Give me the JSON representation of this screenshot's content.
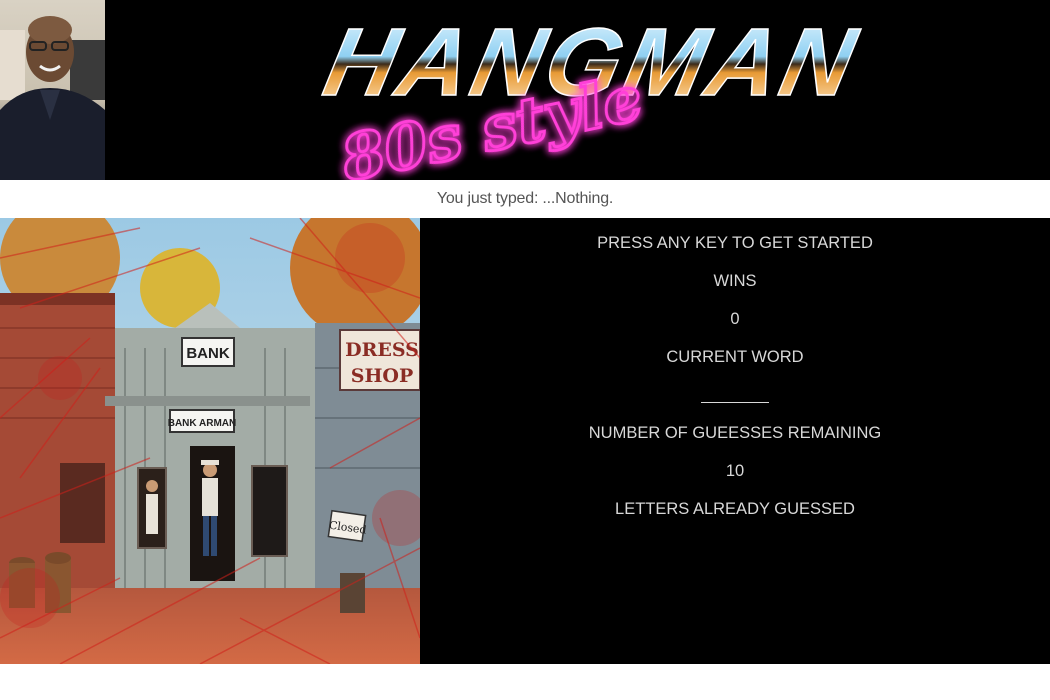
{
  "header": {
    "logo_title": "HANGMAN",
    "logo_subtitle": "80s style"
  },
  "typed_bar": {
    "text": "You just typed: ...Nothing."
  },
  "scene": {
    "sign_bank": "BANK",
    "sign_bank_arman": "BANK ARMAN",
    "sign_dress_shop_line1": "DRESS",
    "sign_dress_shop_line2": "SHOP",
    "sign_closed": "Closed"
  },
  "info": {
    "prompt": "PRESS ANY KEY TO GET STARTED",
    "wins_label": "WINS",
    "wins_value": "0",
    "current_word_label": "CURRENT WORD",
    "guesses_label": "NUMBER OF GUEESSES REMAINING",
    "guesses_value": "10",
    "letters_label": "LETTERS ALREADY GUESSED",
    "letters_value": ""
  },
  "colors": {
    "neon_pink": "#ff3fd8",
    "chrome_top": "#bfe9ff",
    "chrome_mid": "#e89a35",
    "panel_bg": "#000000",
    "panel_text": "#d8d8d8"
  }
}
